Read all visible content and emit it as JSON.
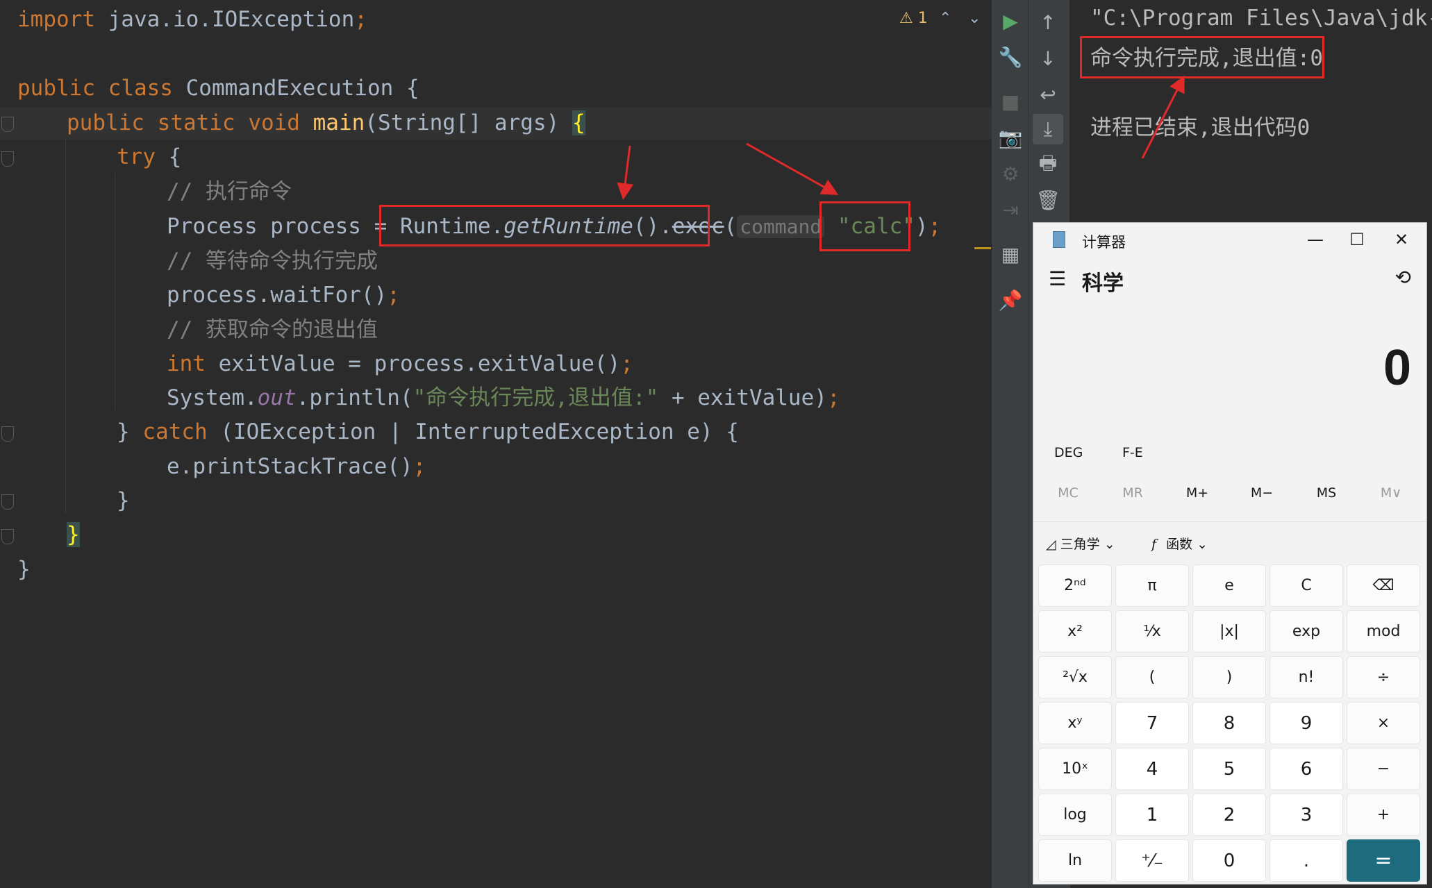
{
  "editor": {
    "warning_count": "1",
    "lines": {
      "l1_kw": "import",
      "l1_rest": " java.io.IOException",
      "l1_sc": ";",
      "l3_kw1": "public",
      "l3_kw2": "class",
      "l3_name": " CommandExecution {",
      "l4_kw1": "public",
      "l4_kw2": "static",
      "l4_kw3": "void",
      "l4_fn": "main",
      "l4_rest": "(String[] args) ",
      "l4_brace": "{",
      "l5_kw": "try",
      "l5_rest": " {",
      "l6_comment": "// 执行命令",
      "l7_a": "Process process = ",
      "l7_runtime": "Runtime.",
      "l7_getrt": "getRuntime",
      "l7_paren": "().",
      "l7_exec": "exec",
      "l7_open": "(",
      "l7_hint": "command",
      "l7_str": "\"calc\"",
      "l7_close": ")",
      "l7_sc": ";",
      "l8_comment": "// 等待命令执行完成",
      "l9_code": "process.waitFor()",
      "l9_sc": ";",
      "l10_comment": "// 获取命令的退出值",
      "l11_kw": "int",
      "l11_rest": " exitValue = process.exitValue()",
      "l11_sc": ";",
      "l12_a": "System.",
      "l12_field": "out",
      "l12_b": ".println(",
      "l12_str": "\"命令执行完成,退出值:\"",
      "l12_c": " + exitValue)",
      "l12_sc": ";",
      "l13_a": "} ",
      "l13_kw": "catch",
      "l13_rest": " (IOException | InterruptedException e) {",
      "l14_code": "e.printStackTrace()",
      "l14_sc": ";",
      "l15": "}",
      "l16": "}",
      "l17": "}"
    }
  },
  "console": {
    "line1": "\"C:\\Program Files\\Java\\jdk-",
    "line2": "命令执行完成,退出值:0",
    "line3": "进程已结束,退出代码0"
  },
  "calculator": {
    "title": "计算器",
    "mode": "科学",
    "display": "0",
    "deg": "DEG",
    "fe": "F-E",
    "memory": [
      "MC",
      "MR",
      "M+",
      "M−",
      "MS",
      "M∨"
    ],
    "trig": "三角学",
    "func": "函数",
    "keys": [
      "2ⁿᵈ",
      "π",
      "e",
      "C",
      "⌫",
      "x²",
      "¹⁄x",
      "|x|",
      "exp",
      "mod",
      "²√x",
      "(",
      ")",
      "n!",
      "÷",
      "xʸ",
      "7",
      "8",
      "9",
      "×",
      "10ˣ",
      "4",
      "5",
      "6",
      "−",
      "log",
      "1",
      "2",
      "3",
      "+",
      "ln",
      "⁺⁄₋",
      "0",
      ".",
      "="
    ]
  },
  "colors": {
    "annotation_red": "#e02a2a",
    "keyword": "#cc7832",
    "equals_key": "#1d6b7c"
  }
}
